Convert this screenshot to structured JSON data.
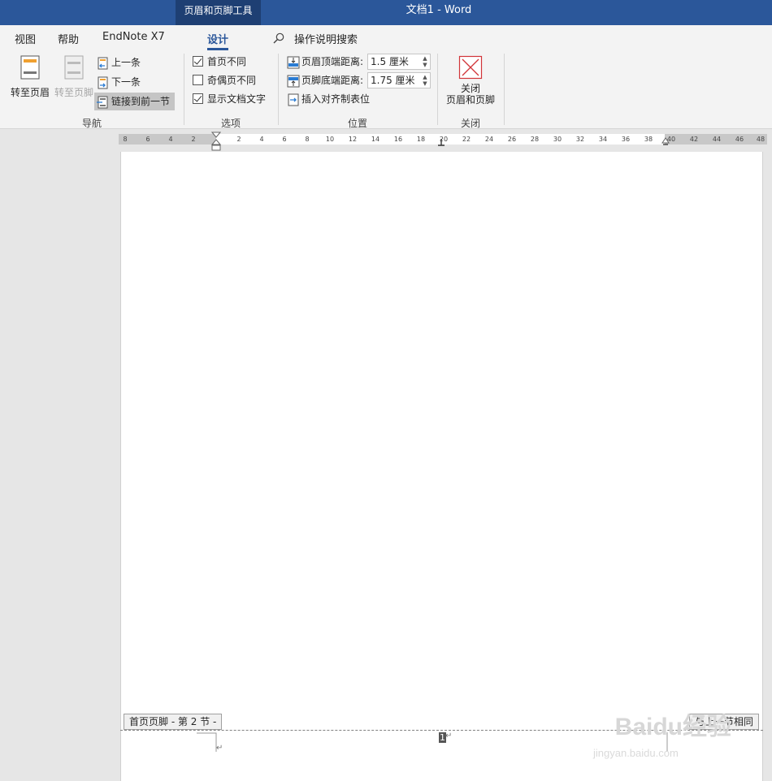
{
  "titlebar": {
    "context_tab": "页眉和页脚工具",
    "document_title": "文档1  -  Word"
  },
  "tabs": [
    {
      "label": "视图"
    },
    {
      "label": "帮助"
    },
    {
      "label": "EndNote X7"
    },
    {
      "label": "设计",
      "active": true
    }
  ],
  "search": {
    "label": "操作说明搜索",
    "icon": "search-icon"
  },
  "ribbon": {
    "navigation": {
      "label": "导航",
      "goto_header": "转至页眉",
      "goto_footer": "转至页脚",
      "previous": "上一条",
      "next": "下一条",
      "link_previous": "链接到前一节"
    },
    "options": {
      "label": "选项",
      "different_first_page": {
        "label": "首页不同",
        "checked": true
      },
      "different_odd_even": {
        "label": "奇偶页不同",
        "checked": false
      },
      "show_document_text": {
        "label": "显示文档文字",
        "checked": true
      }
    },
    "position": {
      "label": "位置",
      "header_from_top": {
        "label": "页眉顶端距离:",
        "value": "1.5 厘米"
      },
      "footer_from_bottom": {
        "label": "页脚底端距离:",
        "value": "1.75 厘米"
      },
      "insert_alignment_tab": "插入对齐制表位"
    },
    "close": {
      "label": "关闭",
      "close_button_line1": "关闭",
      "close_button_line2": "页眉和页脚"
    }
  },
  "ruler": {
    "left_ticks": [
      "8",
      "6",
      "4",
      "2"
    ],
    "right_ticks": [
      "2",
      "4",
      "6",
      "8",
      "10",
      "12",
      "14",
      "16",
      "18",
      "20",
      "22",
      "24",
      "26",
      "28",
      "30",
      "32",
      "34",
      "36",
      "38",
      "40",
      "42",
      "44",
      "46",
      "48"
    ]
  },
  "document": {
    "footer_tag_left": "首页页脚 - 第 2 节 -",
    "footer_tag_right": "与上一节相同",
    "page_number": "1",
    "paragraph_mark": "↵"
  },
  "watermark": {
    "brand": "Baidu经验",
    "url": "jingyan.baidu.com"
  },
  "colors": {
    "title_bar": "#2b579a",
    "context_tab": "#1e3f73",
    "ribbon": "#f3f3f3",
    "close_icon": "#d13438"
  }
}
